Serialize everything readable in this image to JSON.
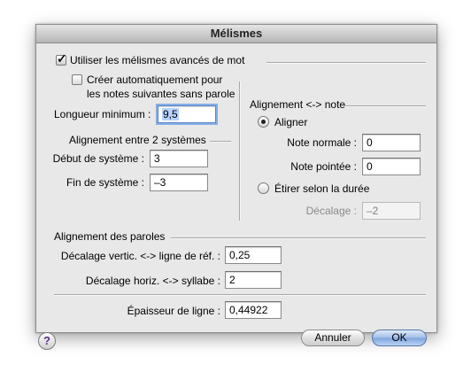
{
  "window": {
    "title": "Mélismes"
  },
  "options": {
    "use_advanced_label": "Utiliser les mélismes avancés de mot",
    "use_advanced_checked": true,
    "auto_create_line1": "Créer automatiquement pour",
    "auto_create_line2": "les notes suivantes sans parole",
    "auto_create_checked": false,
    "min_length_label": "Longueur minimum :",
    "min_length_value": "9,5"
  },
  "systems": {
    "heading": "Alignement entre 2 systèmes",
    "start_label": "Début de système :",
    "start_value": "3",
    "end_label": "Fin de système :",
    "end_value": "–3"
  },
  "note_alignment": {
    "heading": "Alignement <-> note",
    "align_label": "Aligner",
    "align_selected": true,
    "normal_note_label": "Note normale :",
    "normal_note_value": "0",
    "dotted_note_label": "Note pointée :",
    "dotted_note_value": "0",
    "stretch_label": "Étirer selon la durée",
    "stretch_selected": false,
    "offset_label": "Décalage :",
    "offset_value": "–2"
  },
  "lyrics": {
    "heading": "Alignement des paroles",
    "vertical_label": "Décalage vertic. <-> ligne de réf. :",
    "vertical_value": "0,25",
    "horizontal_label": "Décalage horiz. <-> syllabe :",
    "horizontal_value": "2"
  },
  "line": {
    "thickness_label": "Épaisseur de ligne :",
    "thickness_value": "0,44922"
  },
  "buttons": {
    "help_label": "?",
    "cancel_label": "Annuler",
    "ok_label": "OK"
  }
}
